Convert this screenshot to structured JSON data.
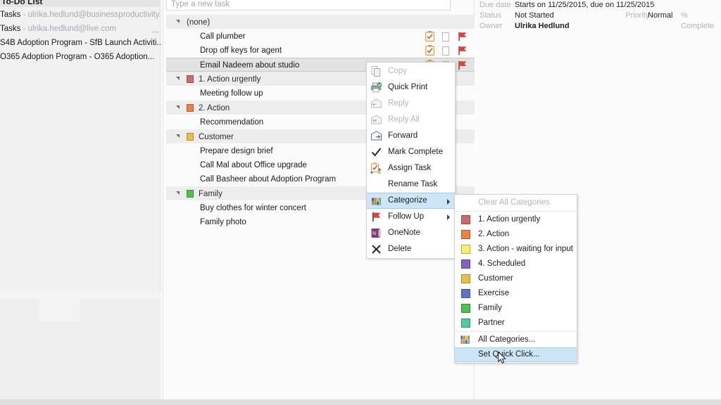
{
  "folder_pane": {
    "header": "To-Do List",
    "items": [
      {
        "name": "Tasks",
        "sep": " - ",
        "mail": "ulrika.hedlund@businessproductivity.com"
      },
      {
        "name": "Tasks",
        "sep": " - ",
        "mail": "ulrika.hedlund@live.com"
      },
      {
        "name": "S4B Adoption Program - SfB Launch Activiti...",
        "sep": "",
        "mail": ""
      },
      {
        "name": "O365 Adoption Program - O365 Adoption...",
        "sep": "",
        "mail": ""
      }
    ]
  },
  "task_pane": {
    "new_task_placeholder": "Type a new task",
    "groups": [
      {
        "label": "(none)",
        "color": null,
        "tasks": [
          {
            "title": "Call plumber",
            "selected": false
          },
          {
            "title": "Drop off keys for agent",
            "selected": false
          },
          {
            "title": "Email Nadeem about studio",
            "selected": true
          }
        ]
      },
      {
        "label": "1. Action urgently",
        "color": "#cd6a6a",
        "tasks": [
          {
            "title": "Meeting follow up",
            "selected": false
          }
        ]
      },
      {
        "label": "2. Action",
        "color": "#ee8041",
        "tasks": [
          {
            "title": "Recommendation",
            "selected": false
          }
        ]
      },
      {
        "label": "Customer",
        "color": "#e9bf4b",
        "tasks": [
          {
            "title": "Prepare design brief",
            "selected": false
          },
          {
            "title": "Call Mal about Office upgrade",
            "selected": false
          },
          {
            "title": "Call Basheer about Adoption Program",
            "selected": false
          }
        ]
      },
      {
        "label": "Family",
        "color": "#4ec14e",
        "tasks": [
          {
            "title": "Buy clothes for winter concert",
            "selected": false
          },
          {
            "title": "Family photo",
            "selected": false
          }
        ]
      }
    ],
    "row_icons": {
      "attachment": "clipboard-check-icon",
      "checkbox": "reminder-checkbox-icon",
      "flag": "follow-up-flag-icon"
    }
  },
  "reading_pane": {
    "fields": [
      {
        "label": "Due date",
        "value": "Starts on 11/25/2015, due on 11/25/2015",
        "bold": false
      },
      {
        "label": "Status",
        "value": "Not Started",
        "bold": false
      },
      {
        "label": "Owner",
        "value": "Ulrika Hedlund",
        "bold": true
      }
    ],
    "priority_label": "Priority",
    "priority_value": "Normal",
    "percent_complete_label": "% Complete"
  },
  "context_menu": {
    "items": [
      {
        "label": "Copy",
        "icon": "copy-icon",
        "disabled": true,
        "submenu": false
      },
      {
        "label": "Quick Print",
        "icon": "quick-print-icon",
        "disabled": false,
        "submenu": false
      },
      {
        "label": "Reply",
        "icon": "reply-icon",
        "disabled": true,
        "submenu": false
      },
      {
        "label": "Reply All",
        "icon": "reply-all-icon",
        "disabled": true,
        "submenu": false
      },
      {
        "label": "Forward",
        "icon": "forward-icon",
        "disabled": false,
        "submenu": false
      },
      {
        "label": "Mark Complete",
        "icon": "checkmark-icon",
        "disabled": false,
        "submenu": false
      },
      {
        "label": "Assign Task",
        "icon": "assign-task-icon",
        "disabled": false,
        "submenu": false
      },
      {
        "label": "Rename Task",
        "icon": "",
        "disabled": false,
        "submenu": false
      },
      {
        "label": "Categorize",
        "icon": "categorize-icon",
        "disabled": false,
        "submenu": true,
        "highlighted": true
      },
      {
        "label": "Follow Up",
        "icon": "flag-icon",
        "disabled": false,
        "submenu": true
      },
      {
        "label": "OneNote",
        "icon": "onenote-icon",
        "disabled": false,
        "submenu": false
      },
      {
        "label": "Delete",
        "icon": "delete-x-icon",
        "disabled": false,
        "submenu": false
      }
    ]
  },
  "categorize_submenu": {
    "clear_all": "Clear All Categories",
    "categories": [
      {
        "label": "1. Action urgently",
        "color": "#cd6a6a"
      },
      {
        "label": "2. Action",
        "color": "#ee8041"
      },
      {
        "label": "3. Action - waiting for input",
        "color": "#f5f069"
      },
      {
        "label": "4. Scheduled",
        "color": "#8262c2"
      },
      {
        "label": "Customer",
        "color": "#e9bf4b"
      },
      {
        "label": "Exercise",
        "color": "#6073c6"
      },
      {
        "label": "Family",
        "color": "#4ec14e"
      },
      {
        "label": "Partner",
        "color": "#4ec9a0"
      }
    ],
    "all_categories": "All Categories...",
    "set_quick_click": "Set Quick Click...",
    "highlighted_item": "Set Quick Click..."
  },
  "colors": {
    "selection_blue": "#cde6f7",
    "group_header_gray": "#ededed",
    "selected_row_gray": "#e2e2e2",
    "flag_red": "#d9453d",
    "label_gray": "#b3b2bd"
  }
}
